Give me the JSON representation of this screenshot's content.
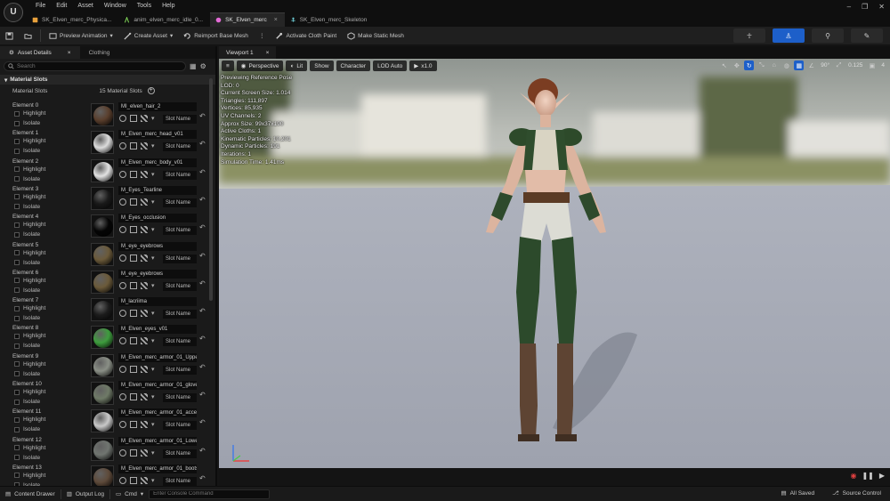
{
  "app": {
    "logo": "unreal-engine-logo"
  },
  "menu": [
    "File",
    "Edit",
    "Asset",
    "Window",
    "Tools",
    "Help"
  ],
  "tabs": [
    {
      "label": "SK_Elven_merc_Physica...",
      "icon": "physics-asset-icon",
      "color": "#e8a13c",
      "active": false
    },
    {
      "label": "anim_elven_merc_idle_0...",
      "icon": "animation-icon",
      "color": "#7ccf55",
      "active": false
    },
    {
      "label": "SK_Elven_merc",
      "icon": "skeletal-mesh-icon",
      "color": "#e36bd6",
      "active": true
    },
    {
      "label": "SK_Elven_merc_Skeleton",
      "icon": "skeleton-icon",
      "color": "#6fcfd8",
      "active": false
    }
  ],
  "toolbar": {
    "preview_animation": "Preview Animation",
    "create_asset": "Create Asset",
    "reimport": "Reimport Base Mesh",
    "activate_cloth": "Activate Cloth Paint",
    "make_static": "Make Static Mesh"
  },
  "left_panel": {
    "tab_details": "Asset Details",
    "tab_clothing": "Clothing",
    "search_placeholder": "Search",
    "category": "Material Slots",
    "slots_label": "Material Slots",
    "slots_count": "15 Material Slots",
    "highlight": "Highlight",
    "isolate": "Isolate",
    "slot_name": "Slot Name",
    "elements": [
      {
        "label": "Element 0",
        "material": "MI_elven_hair_2",
        "thumb": "#5a3f2d"
      },
      {
        "label": "Element 1",
        "material": "M_Elven_merc_head_v01",
        "thumb": "#dcdcdc"
      },
      {
        "label": "Element 2",
        "material": "M_Elven_merc_body_v01",
        "thumb": "#e2e2e2"
      },
      {
        "label": "Element 3",
        "material": "M_Eyes_Tearline",
        "thumb": "#1a1a1a"
      },
      {
        "label": "Element 4",
        "material": "M_Eyes_occlusion",
        "thumb": "#050505"
      },
      {
        "label": "Element 5",
        "material": "M_eye_eyebrows",
        "thumb": "#6b5a3a"
      },
      {
        "label": "Element 6",
        "material": "M_eye_eyebrows",
        "thumb": "#6b5a3a"
      },
      {
        "label": "Element 7",
        "material": "M_lacriima",
        "thumb": "#1c1c1c"
      },
      {
        "label": "Element 8",
        "material": "M_Elven_eyes_v01",
        "thumb": "#3e9d3e"
      },
      {
        "label": "Element 9",
        "material": "M_Elven_merc_armor_01_Upper_",
        "thumb": "#8a8f86"
      },
      {
        "label": "Element 10",
        "material": "M_Elven_merc_armor_01_gloves",
        "thumb": "#6f7a67"
      },
      {
        "label": "Element 11",
        "material": "M_Elven_merc_armor_01_access",
        "thumb": "#c9c9c9"
      },
      {
        "label": "Element 12",
        "material": "M_Elven_merc_armor_01_Lower_",
        "thumb": "#707570"
      },
      {
        "label": "Element 13",
        "material": "M_Elven_merc_armor_01_boots_",
        "thumb": "#5e4a3a"
      }
    ]
  },
  "viewport": {
    "tab": "Viewport 1",
    "perspective": "Perspective",
    "lit": "Lit",
    "show": "Show",
    "character": "Character",
    "lod": "LOD Auto",
    "speed": "x1.0",
    "fov": "90°",
    "snap": "0.125",
    "cam_speed": "4",
    "stats": [
      "Previewing Reference Pose",
      "LOD: 0",
      "Current Screen Size: 1.014",
      "Triangles: 111,897",
      "Vertices: 85,935",
      "UV Channels: 2",
      "Approx Size: 99x37x190",
      "Active Cloths: 1",
      "Kinematic Particles: 10,201",
      "Dynamic Particles: 191",
      "Iterations: 1",
      "Simulation Time: 1.41ms"
    ]
  },
  "statusbar": {
    "content_drawer": "Content Drawer",
    "output_log": "Output Log",
    "cmd": "Cmd",
    "console_placeholder": "Enter Console Command",
    "saved": "All Saved",
    "source_control": "Source Control"
  }
}
